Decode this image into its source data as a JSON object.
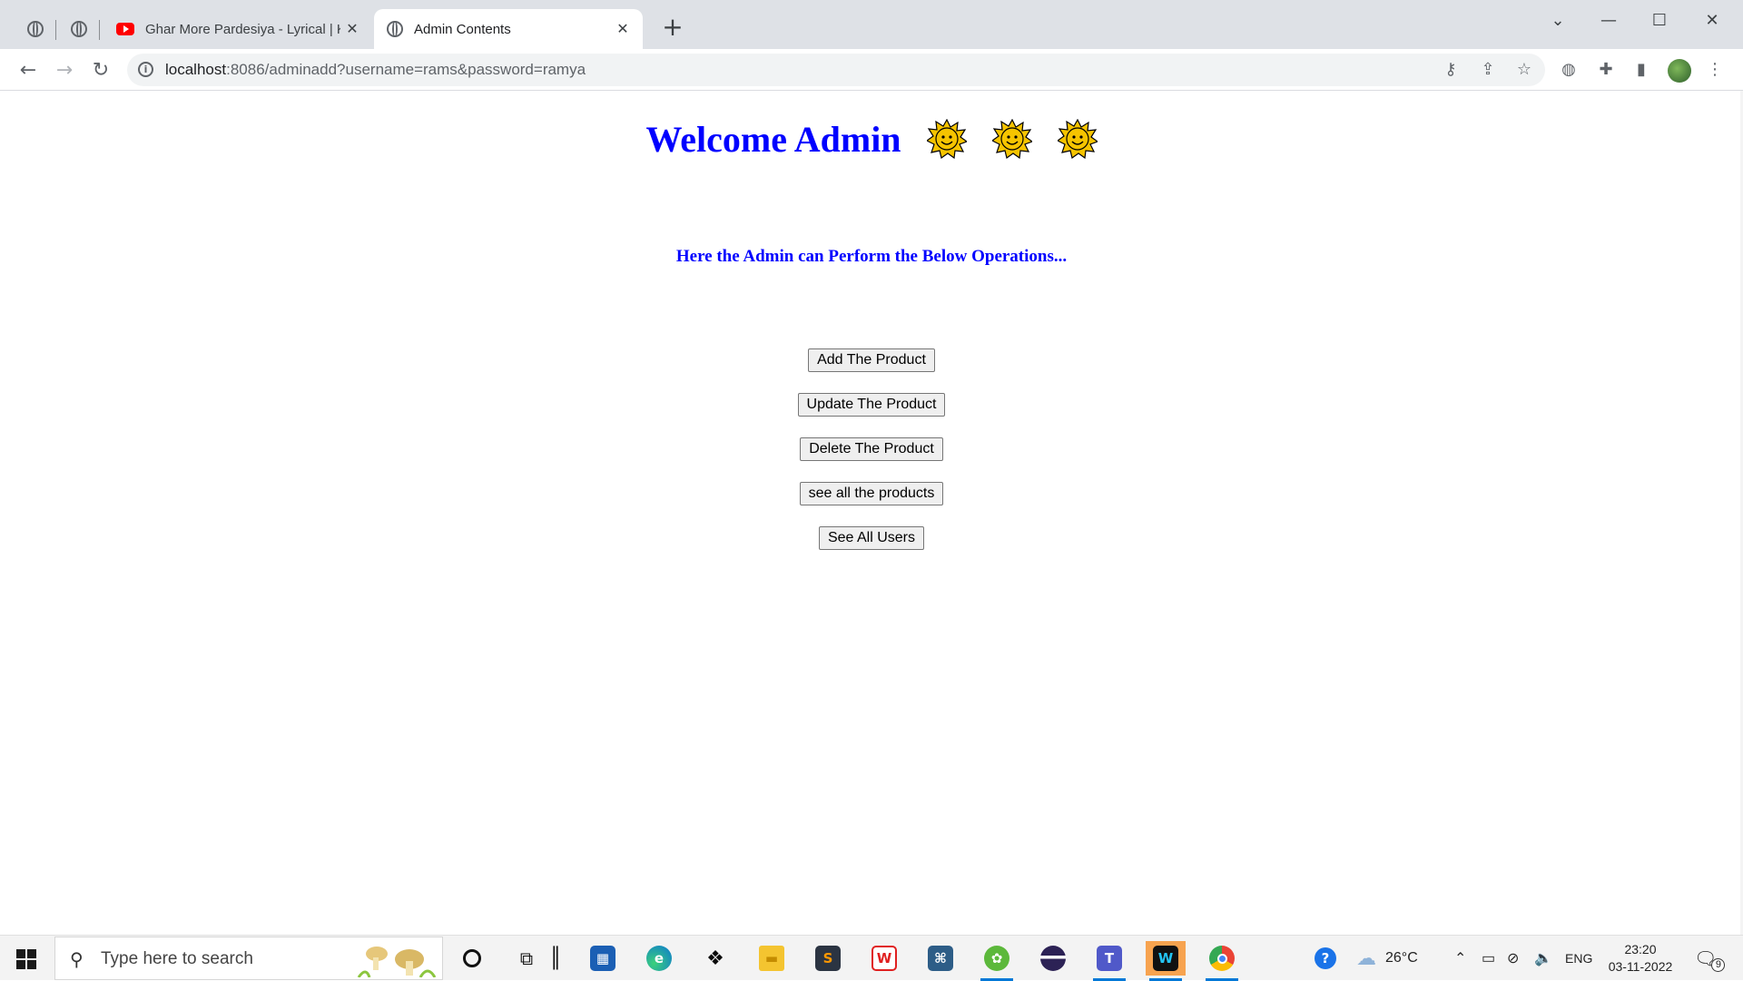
{
  "browser": {
    "tabs": [
      {
        "title": "",
        "icon": "globe-icon",
        "pinned": true
      },
      {
        "title": "",
        "icon": "globe-icon",
        "pinned": true
      },
      {
        "title": "Ghar More Pardesiya - Lyrical | Ka",
        "icon": "youtube-icon"
      },
      {
        "title": "Admin Contents",
        "icon": "globe-icon",
        "active": true
      }
    ],
    "url_host": "localhost",
    "url_rest": ":8086/adminadd?username=rams&password=ramya"
  },
  "page": {
    "heading": "Welcome Admin",
    "subtitle": "Here the Admin can Perform the Below Operations...",
    "buttons": [
      "Add The Product",
      "Update The Product",
      "Delete The Product",
      "see all the products",
      "See All Users"
    ],
    "heading_color": "#0000ff"
  },
  "taskbar": {
    "search_placeholder": "Type here to search",
    "weather": "26°C",
    "language": "ENG",
    "time": "23:20",
    "date": "03-11-2022",
    "notification_count": "9"
  }
}
